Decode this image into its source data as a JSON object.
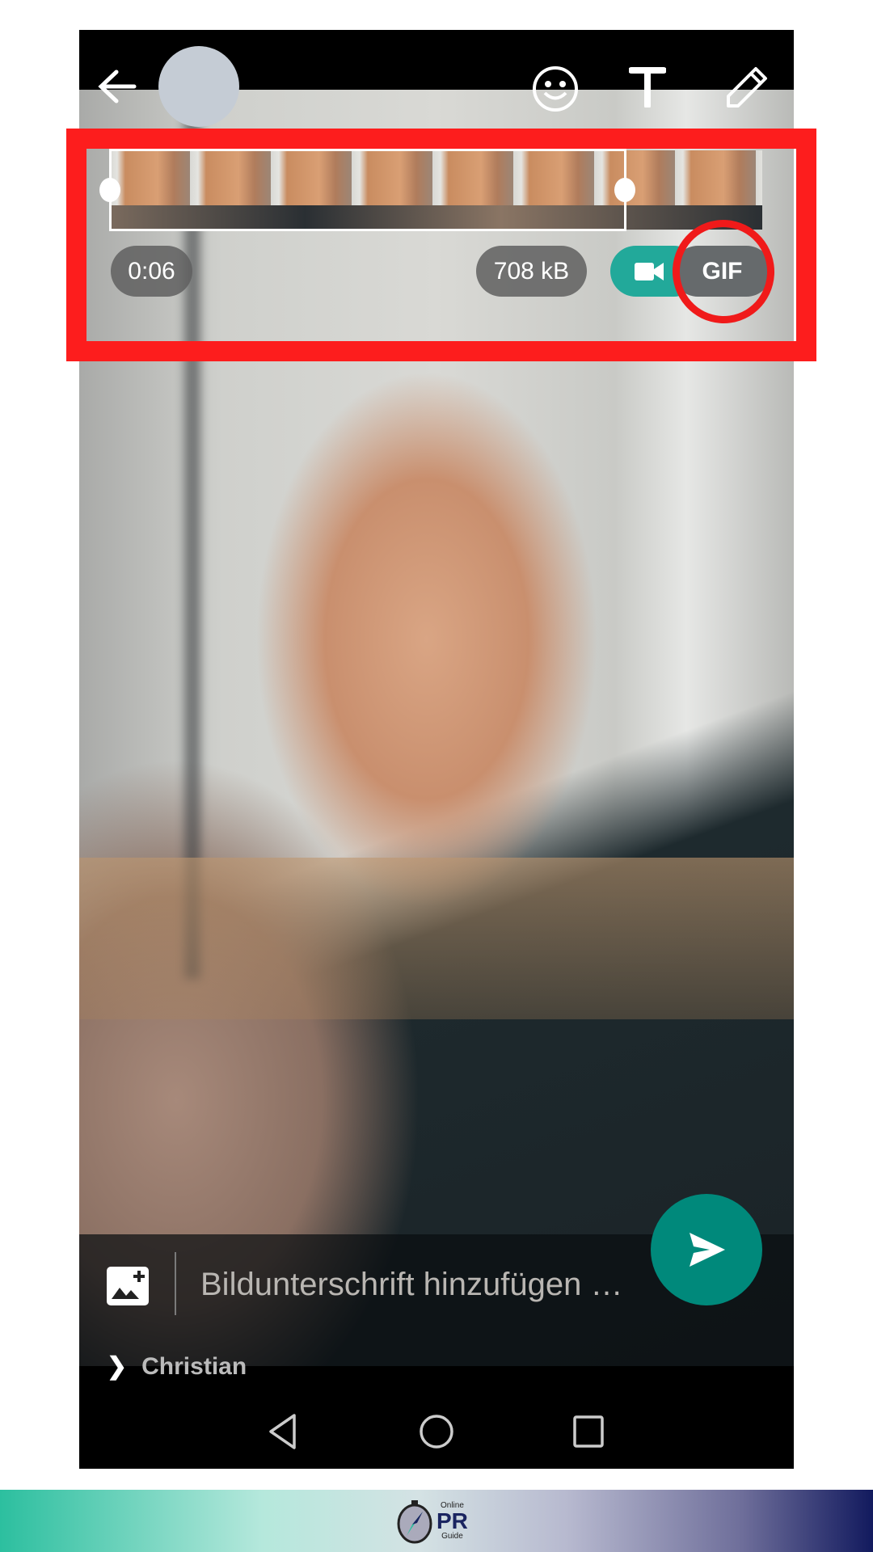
{
  "editor": {
    "duration": "0:06",
    "file_size": "708 kB",
    "gif_label": "GIF",
    "mode_selected": "gif",
    "accent_color": "#00897b",
    "highlight_color": "#fd1d1d"
  },
  "toolbar": {
    "icons": [
      "back-arrow-icon",
      "emoji-icon",
      "text-icon",
      "pencil-icon"
    ]
  },
  "caption": {
    "placeholder": "Bildunterschrift hinzufügen …",
    "recipient": "Christian"
  },
  "footer": {
    "logo_text_top": "Online",
    "logo_text_main": "PR",
    "logo_text_bottom": "Guide"
  }
}
